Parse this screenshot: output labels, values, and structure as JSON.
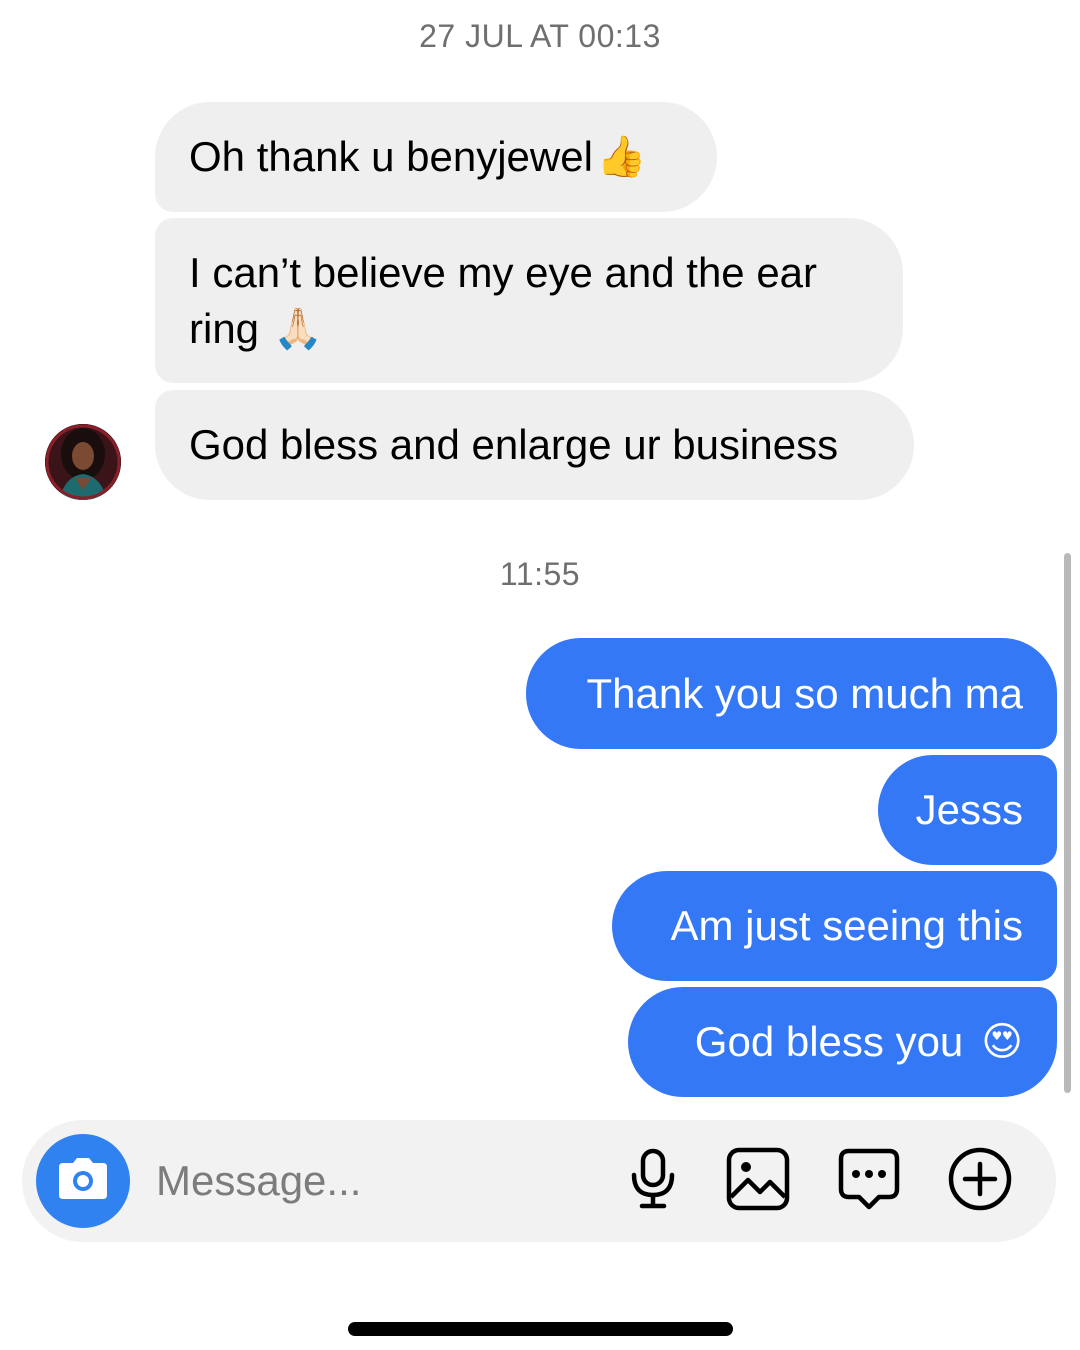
{
  "conversation": {
    "timestamp_top": "27 JUL AT 00:13",
    "timestamp_mid": "11:55",
    "incoming": [
      {
        "text": "Oh thank u benyjewel",
        "emoji": "👍"
      },
      {
        "text_line1": "I can’t believe my eye and the ear",
        "text_line2": "ring",
        "emoji": "🙏🏻"
      },
      {
        "text": "God bless and enlarge ur business"
      }
    ],
    "outgoing": [
      {
        "text": "Thank you so much ma"
      },
      {
        "text": "Jesss"
      },
      {
        "text": "Am just seeing this"
      },
      {
        "text": "God bless you",
        "emoji": "😍"
      }
    ]
  },
  "composer": {
    "placeholder": "Message...",
    "icons": [
      "camera-icon",
      "microphone-icon",
      "image-icon",
      "sticker-chat-icon",
      "add-circle-icon"
    ]
  },
  "colors": {
    "outgoing_bubble": "#3478f6",
    "incoming_bubble": "#efefef",
    "camera_button": "#2f82ef"
  }
}
